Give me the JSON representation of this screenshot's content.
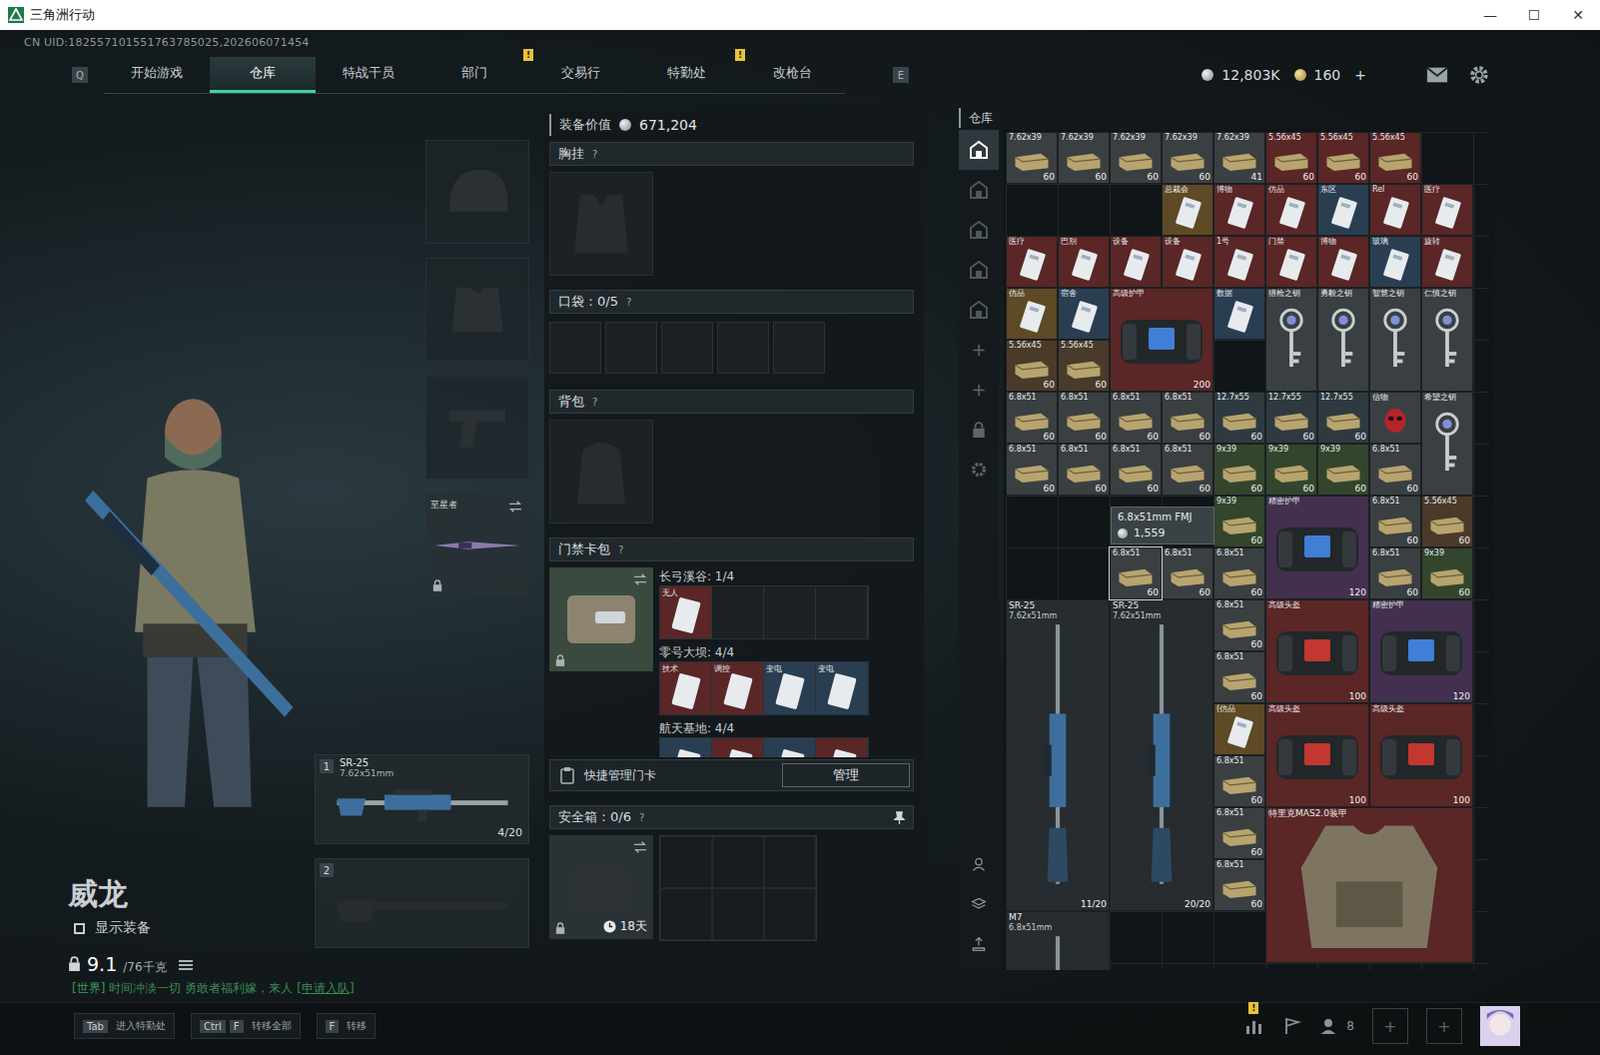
{
  "window": {
    "title": "三角洲行动",
    "controls": [
      "—",
      "☐",
      "✕"
    ]
  },
  "uid": "CN UID:182557101551763785025,202606071454",
  "nav": {
    "left_key": "Q",
    "right_key": "E",
    "alert_mark": "!",
    "tabs": [
      {
        "label": "开始游戏",
        "selected": false,
        "alert": false
      },
      {
        "label": "仓库",
        "selected": true,
        "alert": false
      },
      {
        "label": "特战干员",
        "selected": false,
        "alert": false
      },
      {
        "label": "部门",
        "selected": false,
        "alert": true
      },
      {
        "label": "交易行",
        "selected": false,
        "alert": false
      },
      {
        "label": "特勤处",
        "selected": false,
        "alert": true
      },
      {
        "label": "改枪台",
        "selected": false,
        "alert": false
      }
    ]
  },
  "currency": {
    "coins": "12,803K",
    "tokens": "160",
    "add": "+"
  },
  "character": {
    "name": "威龙",
    "show_gear": {
      "label": "显示装备",
      "checked": false
    },
    "weight": "9.1",
    "weight_max": "/76千克"
  },
  "chat": {
    "channel": "[世界]",
    "message": "时间冲淡一切 勇敢者福利嫁，来人",
    "link": "[申请入队]"
  },
  "melee": {
    "name": "至星者"
  },
  "weapons": [
    {
      "slot": "1",
      "empty": false,
      "name": "SR-25",
      "caliber": "7.62x51mm",
      "ammo": "4/20"
    },
    {
      "slot": "2",
      "empty": true,
      "name": "",
      "caliber": "",
      "ammo": ""
    }
  ],
  "loadout": {
    "value_label": "装备价值",
    "value": "671,204",
    "help": "?",
    "chest": "胸挂",
    "pockets_label": "口袋：",
    "pockets": "0/5",
    "pocket_slots": 5,
    "backpack": "背包",
    "keycards": "门禁卡包",
    "maps": [
      {
        "name": "长弓溪谷: 1/4",
        "cards": [
          {
            "label": "无人",
            "filled": true,
            "color": "#5a2626"
          },
          {
            "label": "",
            "filled": false,
            "color": "#1b2124"
          },
          {
            "label": "",
            "filled": false,
            "color": "#1b2124"
          },
          {
            "label": "",
            "filled": false,
            "color": "#1b2124"
          }
        ]
      },
      {
        "name": "零号大坝: 4/4",
        "cards": [
          {
            "label": "技术",
            "filled": true,
            "color": "#5a2626"
          },
          {
            "label": "调控",
            "filled": true,
            "color": "#5a2626"
          },
          {
            "label": "变电",
            "filled": true,
            "color": "#2a3e52"
          },
          {
            "label": "变电",
            "filled": true,
            "color": "#2a3e52"
          }
        ]
      },
      {
        "name": "航天基地: 4/4",
        "cards": [
          {
            "label": "",
            "filled": true,
            "color": "#2a3e52"
          },
          {
            "label": "",
            "filled": true,
            "color": "#5a2626"
          },
          {
            "label": "",
            "filled": true,
            "color": "#2a3e52"
          },
          {
            "label": "",
            "filled": true,
            "color": "#5a2626"
          }
        ]
      }
    ],
    "quick_manage": "快捷管理门卡",
    "manage_button": "管理",
    "safe_label": "安全箱：",
    "safe": "0/6",
    "safe_slots": 6,
    "safe_time": "18天"
  },
  "warehouse": {
    "title": "仓库",
    "tabs": [
      {
        "selected": true
      },
      {
        "selected": false
      },
      {
        "selected": false
      },
      {
        "selected": false
      },
      {
        "selected": false
      }
    ],
    "add": [
      "+",
      "+"
    ],
    "tooltip": {
      "name": "6.8x51mm FMJ",
      "price": "1,559"
    },
    "items": [
      {
        "kind": "ammo",
        "name": "7.62x39",
        "count": "60",
        "x": 1,
        "y": 1,
        "w": 1,
        "h": 1,
        "color": "#3a3f42",
        "hovered": false
      },
      {
        "kind": "ammo",
        "name": "7.62x39",
        "count": "60",
        "x": 2,
        "y": 1,
        "w": 1,
        "h": 1,
        "color": "#3a3f42",
        "hovered": false
      },
      {
        "kind": "ammo",
        "name": "7.62x39",
        "count": "60",
        "x": 3,
        "y": 1,
        "w": 1,
        "h": 1,
        "color": "#3a3f42",
        "hovered": false
      },
      {
        "kind": "ammo",
        "name": "7.62x39",
        "count": "60",
        "x": 4,
        "y": 1,
        "w": 1,
        "h": 1,
        "color": "#3a3f42",
        "hovered": false
      },
      {
        "kind": "ammo",
        "name": "7.62x39",
        "count": "41",
        "x": 5,
        "y": 1,
        "w": 1,
        "h": 1,
        "color": "#3a3f42",
        "hovered": false
      },
      {
        "kind": "ammo",
        "name": "5.56x45",
        "count": "60",
        "x": 6,
        "y": 1,
        "w": 1,
        "h": 1,
        "color": "#5a2626",
        "hovered": false
      },
      {
        "kind": "ammo",
        "name": "5.56x45",
        "count": "60",
        "x": 7,
        "y": 1,
        "w": 1,
        "h": 1,
        "color": "#5a2626",
        "hovered": false
      },
      {
        "kind": "ammo",
        "name": "5.56x45",
        "count": "60",
        "x": 8,
        "y": 1,
        "w": 1,
        "h": 1,
        "color": "#5a2626",
        "hovered": false
      },
      {
        "kind": "card",
        "name": "总裁会",
        "count": "",
        "x": 4,
        "y": 2,
        "w": 1,
        "h": 1,
        "color": "#5e4a24",
        "hovered": false
      },
      {
        "kind": "card",
        "name": "博物",
        "count": "",
        "x": 5,
        "y": 2,
        "w": 1,
        "h": 1,
        "color": "#5a2626",
        "hovered": false
      },
      {
        "kind": "card",
        "name": "仿品",
        "count": "",
        "x": 6,
        "y": 2,
        "w": 1,
        "h": 1,
        "color": "#5a2626",
        "hovered": false
      },
      {
        "kind": "card",
        "name": "东区",
        "count": "",
        "x": 7,
        "y": 2,
        "w": 1,
        "h": 1,
        "color": "#2a3e52",
        "hovered": false
      },
      {
        "kind": "card",
        "name": "Rel",
        "count": "",
        "x": 8,
        "y": 2,
        "w": 1,
        "h": 1,
        "color": "#5a2626",
        "hovered": false
      },
      {
        "kind": "card",
        "name": "医疗",
        "count": "",
        "x": 9,
        "y": 2,
        "w": 1,
        "h": 1,
        "color": "#5a2626",
        "hovered": false
      },
      {
        "kind": "card",
        "name": "医疗",
        "count": "",
        "x": 1,
        "y": 3,
        "w": 1,
        "h": 1,
        "color": "#5a2626",
        "hovered": false
      },
      {
        "kind": "card",
        "name": "巴别",
        "count": "",
        "x": 2,
        "y": 3,
        "w": 1,
        "h": 1,
        "color": "#5a2626",
        "hovered": false
      },
      {
        "kind": "card",
        "name": "设备",
        "count": "",
        "x": 3,
        "y": 3,
        "w": 1,
        "h": 1,
        "color": "#5a2626",
        "hovered": false
      },
      {
        "kind": "card",
        "name": "设备",
        "count": "",
        "x": 4,
        "y": 3,
        "w": 1,
        "h": 1,
        "color": "#5a2626",
        "hovered": false
      },
      {
        "kind": "card",
        "name": "1号",
        "count": "",
        "x": 5,
        "y": 3,
        "w": 1,
        "h": 1,
        "color": "#5a2626",
        "hovered": false
      },
      {
        "kind": "card",
        "name": "门禁",
        "count": "",
        "x": 6,
        "y": 3,
        "w": 1,
        "h": 1,
        "color": "#5a2626",
        "hovered": false
      },
      {
        "kind": "card",
        "name": "博物",
        "count": "",
        "x": 7,
        "y": 3,
        "w": 1,
        "h": 1,
        "color": "#5a2626",
        "hovered": false
      },
      {
        "kind": "card",
        "name": "玻璃",
        "count": "",
        "x": 8,
        "y": 3,
        "w": 1,
        "h": 1,
        "color": "#2a3e52",
        "hovered": false
      },
      {
        "kind": "card",
        "name": "旋转",
        "count": "",
        "x": 9,
        "y": 3,
        "w": 1,
        "h": 1,
        "color": "#5a2626",
        "hovered": false
      },
      {
        "kind": "card",
        "name": "仿品",
        "count": "",
        "x": 1,
        "y": 4,
        "w": 1,
        "h": 1,
        "color": "#5e4a24",
        "hovered": false
      },
      {
        "kind": "card",
        "name": "宿舍",
        "count": "",
        "x": 2,
        "y": 4,
        "w": 1,
        "h": 1,
        "color": "#2a3e52",
        "hovered": false
      },
      {
        "kind": "armor",
        "name": "高级护甲",
        "count": "200",
        "x": 3,
        "y": 4,
        "w": 2,
        "h": 2,
        "color": "#5a2626",
        "hovered": false
      },
      {
        "kind": "card",
        "name": "数据",
        "count": "",
        "x": 5,
        "y": 4,
        "w": 1,
        "h": 1,
        "color": "#2a3e52",
        "hovered": false
      },
      {
        "kind": "key",
        "name": "猎枪之钥",
        "count": "",
        "x": 6,
        "y": 4,
        "w": 1,
        "h": 2,
        "color": "#3a3f42",
        "hovered": false
      },
      {
        "kind": "key",
        "name": "勇毅之钥",
        "count": "",
        "x": 7,
        "y": 4,
        "w": 1,
        "h": 2,
        "color": "#3a3f42",
        "hovered": false
      },
      {
        "kind": "key",
        "name": "智慧之钥",
        "count": "",
        "x": 8,
        "y": 4,
        "w": 1,
        "h": 2,
        "color": "#3a3f42",
        "hovered": false
      },
      {
        "kind": "key",
        "name": "仁慎之钥",
        "count": "",
        "x": 9,
        "y": 4,
        "w": 1,
        "h": 2,
        "color": "#3a3f42",
        "hovered": false
      },
      {
        "kind": "ammo",
        "name": "5.56x45",
        "count": "60",
        "x": 1,
        "y": 5,
        "w": 1,
        "h": 1,
        "color": "#4a3a2a",
        "hovered": false
      },
      {
        "kind": "ammo",
        "name": "5.56x45",
        "count": "60",
        "x": 2,
        "y": 5,
        "w": 1,
        "h": 1,
        "color": "#4a3a2a",
        "hovered": false
      },
      {
        "kind": "ammo",
        "name": "6.8x51",
        "count": "60",
        "x": 1,
        "y": 6,
        "w": 1,
        "h": 1,
        "color": "#3a3f42",
        "hovered": false
      },
      {
        "kind": "ammo",
        "name": "6.8x51",
        "count": "60",
        "x": 2,
        "y": 6,
        "w": 1,
        "h": 1,
        "color": "#3a3f42",
        "hovered": false
      },
      {
        "kind": "ammo",
        "name": "6.8x51",
        "count": "60",
        "x": 3,
        "y": 6,
        "w": 1,
        "h": 1,
        "color": "#3a3f42",
        "hovered": false
      },
      {
        "kind": "ammo",
        "name": "6.8x51",
        "count": "60",
        "x": 4,
        "y": 6,
        "w": 1,
        "h": 1,
        "color": "#3a3f42",
        "hovered": false
      },
      {
        "kind": "ammo",
        "name": "12.7x55",
        "count": "60",
        "x": 5,
        "y": 6,
        "w": 1,
        "h": 1,
        "color": "#2f3a40",
        "hovered": false
      },
      {
        "kind": "ammo",
        "name": "12.7x55",
        "count": "60",
        "x": 6,
        "y": 6,
        "w": 1,
        "h": 1,
        "color": "#2f3a40",
        "hovered": false
      },
      {
        "kind": "ammo",
        "name": "12.7x55",
        "count": "60",
        "x": 7,
        "y": 6,
        "w": 1,
        "h": 1,
        "color": "#2f3a40",
        "hovered": false
      },
      {
        "kind": "mask",
        "name": "信物",
        "count": "",
        "x": 8,
        "y": 6,
        "w": 1,
        "h": 1,
        "color": "#3a3f42",
        "hovered": false
      },
      {
        "kind": "key",
        "name": "希望之钥",
        "count": "",
        "x": 9,
        "y": 6,
        "w": 1,
        "h": 2,
        "color": "#3a3f42",
        "hovered": false
      },
      {
        "kind": "ammo",
        "name": "6.8x51",
        "count": "60",
        "x": 1,
        "y": 7,
        "w": 1,
        "h": 1,
        "color": "#3a3f42",
        "hovered": false
      },
      {
        "kind": "ammo",
        "name": "6.8x51",
        "count": "60",
        "x": 2,
        "y": 7,
        "w": 1,
        "h": 1,
        "color": "#3a3f42",
        "hovered": false
      },
      {
        "kind": "ammo",
        "name": "6.8x51",
        "count": "60",
        "x": 3,
        "y": 7,
        "w": 1,
        "h": 1,
        "color": "#3a3f42",
        "hovered": false
      },
      {
        "kind": "ammo",
        "name": "6.8x51",
        "count": "60",
        "x": 4,
        "y": 7,
        "w": 1,
        "h": 1,
        "color": "#3a3f42",
        "hovered": false
      },
      {
        "kind": "ammo",
        "name": "9x39",
        "count": "60",
        "x": 5,
        "y": 7,
        "w": 1,
        "h": 1,
        "color": "#33452c",
        "hovered": false
      },
      {
        "kind": "ammo",
        "name": "9x39",
        "count": "60",
        "x": 6,
        "y": 7,
        "w": 1,
        "h": 1,
        "color": "#33452c",
        "hovered": false
      },
      {
        "kind": "ammo",
        "name": "9x39",
        "count": "60",
        "x": 7,
        "y": 7,
        "w": 1,
        "h": 1,
        "color": "#33452c",
        "hovered": false
      },
      {
        "kind": "ammo",
        "name": "6.8x51",
        "count": "60",
        "x": 8,
        "y": 7,
        "w": 1,
        "h": 1,
        "color": "#3a3f42",
        "hovered": false
      },
      {
        "kind": "ammo",
        "name": "9x39",
        "count": "60",
        "x": 5,
        "y": 8,
        "w": 1,
        "h": 1,
        "color": "#33452c",
        "hovered": false
      },
      {
        "kind": "armor",
        "name": "精密护甲",
        "count": "120",
        "x": 6,
        "y": 8,
        "w": 2,
        "h": 2,
        "color": "#43304f",
        "hovered": false
      },
      {
        "kind": "ammo",
        "name": "6.8x51",
        "count": "60",
        "x": 8,
        "y": 8,
        "w": 1,
        "h": 1,
        "color": "#3a3f42",
        "hovered": false
      },
      {
        "kind": "ammo",
        "name": "5.56x45",
        "count": "60",
        "x": 9,
        "y": 8,
        "w": 1,
        "h": 1,
        "color": "#4a3a2a",
        "hovered": false
      },
      {
        "kind": "ammo",
        "name": "6.8x51",
        "count": "60",
        "x": 3,
        "y": 9,
        "w": 1,
        "h": 1,
        "color": "#3a3f42",
        "hovered": true
      },
      {
        "kind": "ammo",
        "name": "6.8x51",
        "count": "60",
        "x": 4,
        "y": 9,
        "w": 1,
        "h": 1,
        "color": "#3a3f42",
        "hovered": false
      },
      {
        "kind": "ammo",
        "name": "6.8x51",
        "count": "60",
        "x": 5,
        "y": 9,
        "w": 1,
        "h": 1,
        "color": "#3a3f42",
        "hovered": false
      },
      {
        "kind": "ammo",
        "name": "6.8x51",
        "count": "60",
        "x": 8,
        "y": 9,
        "w": 1,
        "h": 1,
        "color": "#3a3f42",
        "hovered": false
      },
      {
        "kind": "ammo",
        "name": "9x39",
        "count": "60",
        "x": 9,
        "y": 9,
        "w": 1,
        "h": 1,
        "color": "#33452c",
        "hovered": false
      },
      {
        "kind": "gun",
        "name": "SR-25",
        "sub": "7.62x51mm",
        "count": "11/20",
        "x": 1,
        "y": 10,
        "w": 2,
        "h": 6,
        "color": "#262c2f",
        "hovered": false
      },
      {
        "kind": "gun",
        "name": "SR-25",
        "sub": "7.62x51mm",
        "count": "20/20",
        "x": 3,
        "y": 10,
        "w": 2,
        "h": 6,
        "color": "#262c2f",
        "hovered": false
      },
      {
        "kind": "ammo",
        "name": "6.8x51",
        "count": "60",
        "x": 5,
        "y": 10,
        "w": 1,
        "h": 1,
        "color": "#3a3f42",
        "hovered": false
      },
      {
        "kind": "helmet",
        "name": "高级头盔",
        "count": "100",
        "x": 6,
        "y": 10,
        "w": 2,
        "h": 2,
        "color": "#5a2626",
        "hovered": false
      },
      {
        "kind": "armor",
        "name": "精密护甲",
        "count": "120",
        "x": 8,
        "y": 10,
        "w": 2,
        "h": 2,
        "color": "#43304f",
        "hovered": false
      },
      {
        "kind": "ammo",
        "name": "6.8x51",
        "count": "60",
        "x": 5,
        "y": 11,
        "w": 1,
        "h": 1,
        "color": "#3a3f42",
        "hovered": false
      },
      {
        "kind": "card",
        "name": "(仿品",
        "count": "",
        "x": 5,
        "y": 12,
        "w": 1,
        "h": 1,
        "color": "#5e4a24",
        "hovered": false
      },
      {
        "kind": "helmet",
        "name": "高级头盔",
        "count": "100",
        "x": 6,
        "y": 12,
        "w": 2,
        "h": 2,
        "color": "#5a2626",
        "hovered": false
      },
      {
        "kind": "helmet",
        "name": "高级头盔",
        "count": "100",
        "x": 8,
        "y": 12,
        "w": 2,
        "h": 2,
        "color": "#5a2626",
        "hovered": false
      },
      {
        "kind": "ammo",
        "name": "6.8x51",
        "count": "60",
        "x": 5,
        "y": 13,
        "w": 1,
        "h": 1,
        "color": "#3a3f42",
        "hovered": false
      },
      {
        "kind": "ammo",
        "name": "6.8x51",
        "count": "60",
        "x": 5,
        "y": 14,
        "w": 1,
        "h": 1,
        "color": "#3a3f42",
        "hovered": false
      },
      {
        "kind": "vest",
        "name": "特里克MAS2.0装甲",
        "count": "",
        "x": 6,
        "y": 14,
        "w": 4,
        "h": 3,
        "color": "#5a2626",
        "hovered": false
      },
      {
        "kind": "ammo",
        "name": "6.8x51",
        "count": "60",
        "x": 5,
        "y": 15,
        "w": 1,
        "h": 1,
        "color": "#3a3f42",
        "hovered": false
      },
      {
        "kind": "gun",
        "name": "M7",
        "sub": "6.8x51mm",
        "count": "",
        "x": 1,
        "y": 16,
        "w": 2,
        "h": 6,
        "color": "#262c2f",
        "hovered": false
      }
    ]
  },
  "bottom": {
    "hotkeys": [
      {
        "keys": [
          "Tab"
        ],
        "label": "进入特勤处"
      },
      {
        "keys": [
          "Ctrl",
          "F"
        ],
        "label": "转移全部"
      },
      {
        "keys": [
          "F"
        ],
        "label": "转移"
      }
    ],
    "friends": "8",
    "alert": "!",
    "slots": [
      "+",
      "+"
    ]
  }
}
